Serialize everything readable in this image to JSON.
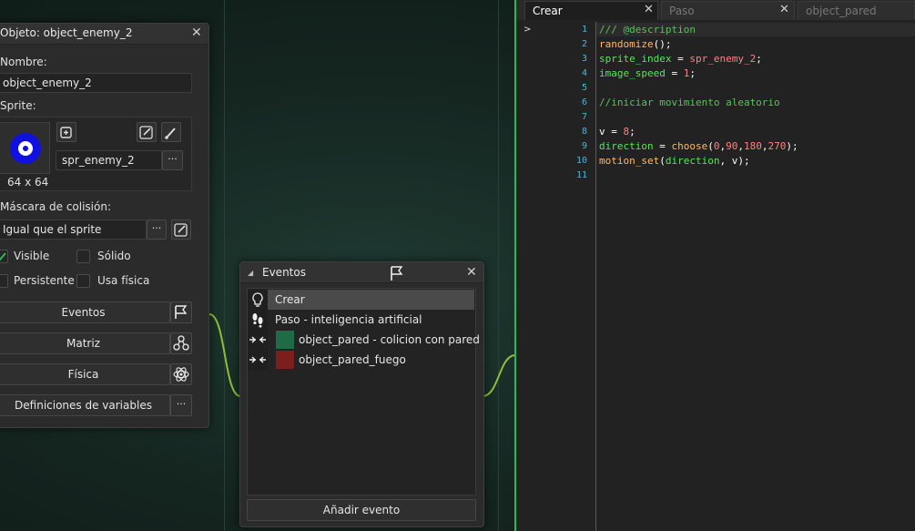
{
  "object_window": {
    "title": "Objeto: object_enemy_2",
    "name_label": "Nombre:",
    "name_value": "object_enemy_2",
    "sprite_label": "Sprite:",
    "sprite_size": "64 x 64",
    "sprite_name": "spr_enemy_2",
    "sprite_browse": "···",
    "mask_label": "Máscara de colisión:",
    "mask_value": "Igual que el sprite",
    "mask_browse": "···",
    "visible_label": "Visible",
    "visible_checked": true,
    "solid_label": "Sólido",
    "solid_checked": false,
    "persistent_label": "Persistente",
    "persistent_checked": false,
    "physics_label": "Usa física",
    "physics_checked": false,
    "events_button": "Eventos",
    "matrix_button": "Matriz",
    "physics_button": "Física",
    "variables_button": "Definiciones de variables",
    "variables_more": "···"
  },
  "events_window": {
    "title": "Eventos",
    "events": [
      {
        "label": "Crear",
        "icon": "lightbulb-icon",
        "color": null,
        "selected": true
      },
      {
        "label": "Paso - inteligencia artificial",
        "icon": "footsteps-icon",
        "color": null,
        "selected": false
      },
      {
        "label": "object_pared - colicion con pared",
        "icon": "collision-icon",
        "color": "#1d6b47",
        "selected": false
      },
      {
        "label": "object_pared_fuego",
        "icon": "collision-icon",
        "color": "#7a1e1e",
        "selected": false
      }
    ],
    "add_event_button": "Añadir evento"
  },
  "editor": {
    "tabs": [
      {
        "label": "Crear",
        "active": true
      },
      {
        "label": "Paso",
        "active": false
      },
      {
        "label": "object_pared",
        "active": false
      }
    ],
    "lines": [
      [
        {
          "t": "/// @description",
          "c": "#5fbf5f"
        }
      ],
      [
        {
          "t": "randomize",
          "c": "#ffb871"
        },
        {
          "t": "();",
          "c": "#ffffff"
        }
      ],
      [
        {
          "t": "sprite_index",
          "c": "#58e55a"
        },
        {
          "t": " = ",
          "c": "#ffffff"
        },
        {
          "t": "spr_enemy_2",
          "c": "#ff8080"
        },
        {
          "t": ";",
          "c": "#ffffff"
        }
      ],
      [
        {
          "t": "image_speed",
          "c": "#58e55a"
        },
        {
          "t": " = ",
          "c": "#ffffff"
        },
        {
          "t": "1",
          "c": "#ff8080"
        },
        {
          "t": ";",
          "c": "#ffffff"
        }
      ],
      [],
      [
        {
          "t": "//iniciar movimiento aleatorio",
          "c": "#5fbf5f"
        }
      ],
      [],
      [
        {
          "t": "v",
          "c": "#ffffff"
        },
        {
          "t": " = ",
          "c": "#ffffff"
        },
        {
          "t": "8",
          "c": "#ff8080"
        },
        {
          "t": ";",
          "c": "#ffffff"
        }
      ],
      [
        {
          "t": "direction",
          "c": "#58e55a"
        },
        {
          "t": " = ",
          "c": "#ffffff"
        },
        {
          "t": "choose",
          "c": "#ffb871"
        },
        {
          "t": "(",
          "c": "#ffffff"
        },
        {
          "t": "0",
          "c": "#ff8080"
        },
        {
          "t": ",",
          "c": "#ffffff"
        },
        {
          "t": "90",
          "c": "#ff8080"
        },
        {
          "t": ",",
          "c": "#ffffff"
        },
        {
          "t": "180",
          "c": "#ff8080"
        },
        {
          "t": ",",
          "c": "#ffffff"
        },
        {
          "t": "270",
          "c": "#ff8080"
        },
        {
          "t": ");",
          "c": "#ffffff"
        }
      ],
      [
        {
          "t": "motion_set",
          "c": "#ffb871"
        },
        {
          "t": "(",
          "c": "#ffffff"
        },
        {
          "t": "direction",
          "c": "#58e55a"
        },
        {
          "t": ", ",
          "c": "#ffffff"
        },
        {
          "t": "v",
          "c": "#ffffff"
        },
        {
          "t": ");",
          "c": "#ffffff"
        }
      ],
      []
    ]
  },
  "colors": {
    "accent_green": "#2fb55a",
    "wire_green": "#8fbf3a",
    "sprite_blue": "#1010e0"
  }
}
